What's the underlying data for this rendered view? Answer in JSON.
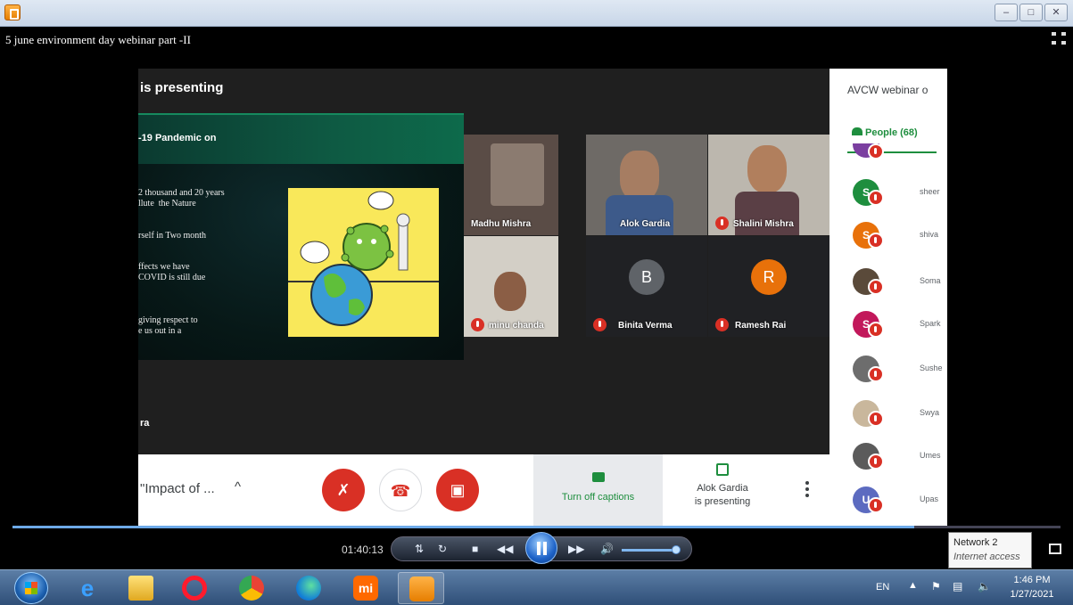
{
  "window": {
    "video_title": "5 june environment day webinar part -II",
    "buttons": [
      "minimize",
      "maximize",
      "close"
    ]
  },
  "meet": {
    "presenting_label": "is presenting",
    "slide": {
      "title": "-19 Pandemic on",
      "lines": [
        "2 thousand and 20 years\nllute  the Nature",
        "rself in Two month",
        "ffects we have\nCOVID is still due",
        "giving respect to\ne us out in a"
      ]
    },
    "tiles": [
      {
        "name": "Madhu Mishra",
        "muted": false
      },
      {
        "name": "Alok Gardia",
        "muted": false
      },
      {
        "name": "Shalini Mishra",
        "muted": true
      },
      {
        "name": "minu chanda",
        "muted": true
      },
      {
        "name": "Binita Verma",
        "initial": "B",
        "muted": true
      },
      {
        "name": "Ramesh Rai",
        "initial": "R",
        "muted": true
      }
    ],
    "left_partial_name": "ra",
    "controls": {
      "meeting_topic": "\"Impact of ...",
      "caret": "^",
      "captions_label": "Turn off captions",
      "presenter_line1": "Alok Gardia",
      "presenter_line2": "is presenting"
    },
    "panel": {
      "title": "AVCW webinar o",
      "tab_label": "People (68)",
      "people": [
        {
          "initial": "S",
          "name": "sheer",
          "color": "#1e8e3e"
        },
        {
          "initial": "S",
          "name": "shiva",
          "color": "#e8710a"
        },
        {
          "initial": "",
          "name": "Soma",
          "color": "#5a4a3a"
        },
        {
          "initial": "S",
          "name": "Spark",
          "color": "#c2185b"
        },
        {
          "initial": "",
          "name": "Sushe",
          "color": "#6d6d6d"
        },
        {
          "initial": "",
          "name": "Swya",
          "color": "#c9b79c"
        },
        {
          "initial": "",
          "name": "Umes",
          "color": "#5b5b5b"
        },
        {
          "initial": "U",
          "name": "Upas",
          "color": "#5c6bc0"
        }
      ]
    }
  },
  "player": {
    "time": "01:40:13",
    "progress": 0.86
  },
  "tooltip": {
    "line1": "Network  2",
    "line2": "Internet access"
  },
  "tray": {
    "lang": "EN",
    "time": "1:46 PM",
    "date": "1/27/2021"
  }
}
